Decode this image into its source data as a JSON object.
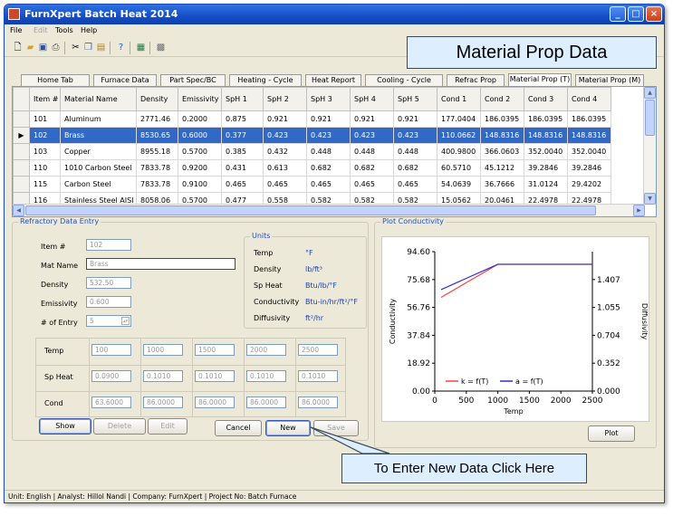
{
  "window": {
    "title": "FurnXpert Batch Heat 2014"
  },
  "menu": {
    "file": "File",
    "edit": "Edit",
    "tools": "Tools",
    "help": "Help"
  },
  "callouts": {
    "material_prop": "Material Prop Data",
    "new_data": "To Enter New Data Click Here"
  },
  "tabs": [
    "Home Tab",
    "Furnace Data",
    "Part Spec/BC",
    "Heating - Cycle",
    "Heat Report",
    "Cooling - Cycle",
    "Refrac Prop",
    "Material Prop (T)",
    "Material Prop (M)"
  ],
  "grid": {
    "columns": [
      "Item #",
      "Material Name",
      "Density",
      "Emissivity",
      "SpH 1",
      "SpH 2",
      "SpH 3",
      "SpH 4",
      "SpH 5",
      "Cond 1",
      "Cond 2",
      "Cond 3",
      "Cond 4"
    ],
    "rows": [
      [
        "101",
        "Aluminum",
        "2771.46",
        "0.2000",
        "0.875",
        "0.921",
        "0.921",
        "0.921",
        "0.921",
        "177.0404",
        "186.0395",
        "186.0395",
        "186.0395"
      ],
      [
        "102",
        "Brass",
        "8530.65",
        "0.6000",
        "0.377",
        "0.423",
        "0.423",
        "0.423",
        "0.423",
        "110.0662",
        "148.8316",
        "148.8316",
        "148.8316"
      ],
      [
        "103",
        "Copper",
        "8955.18",
        "0.5700",
        "0.385",
        "0.432",
        "0.448",
        "0.448",
        "0.448",
        "400.9800",
        "366.0603",
        "352.0040",
        "352.0040"
      ],
      [
        "110",
        "1010 Carbon Steel",
        "7833.78",
        "0.9200",
        "0.431",
        "0.613",
        "0.682",
        "0.682",
        "0.682",
        "60.5710",
        "45.1212",
        "39.2846",
        "39.2846"
      ],
      [
        "115",
        "Carbon Steel",
        "7833.78",
        "0.9100",
        "0.465",
        "0.465",
        "0.465",
        "0.465",
        "0.465",
        "54.0639",
        "36.7666",
        "31.0124",
        "29.4202"
      ],
      [
        "116",
        "Stainless Steel AISI 3...",
        "8058.06",
        "0.5700",
        "0.477",
        "0.558",
        "0.582",
        "0.582",
        "0.582",
        "15.0562",
        "20.0461",
        "22.4978",
        "22.4978"
      ],
      [
        "118",
        "Tungsten",
        "19302.50",
        "0.5500",
        "0.130",
        "0.143",
        "0.147",
        "0.147",
        "0.147",
        "173.9253",
        "124.5647",
        "118.0269",
        "118.0269"
      ]
    ],
    "selected_row": 1
  },
  "refractory": {
    "legend": "Refractory Data Entry",
    "item_label": "Item #",
    "item_value": "102",
    "mat_label": "Mat Name",
    "mat_value": "Brass",
    "density_label": "Density",
    "density_value": "532.50",
    "emissivity_label": "Emissivity",
    "emissivity_value": "0.600",
    "entry_label": "# of Entry",
    "entry_value": "5",
    "units_legend": "Units",
    "units": [
      {
        "name": "Temp",
        "unit": "°F"
      },
      {
        "name": "Density",
        "unit": "lb/ft³"
      },
      {
        "name": "Sp Heat",
        "unit": "Btu/lb/°F"
      },
      {
        "name": "Conductivity",
        "unit": "Btu-in/hr/ft²/°F"
      },
      {
        "name": "Diffusivity",
        "unit": "ft²/hr"
      }
    ],
    "matrix_rows": [
      {
        "label": "Temp",
        "values": [
          "100",
          "1000",
          "1500",
          "2000",
          "2500"
        ]
      },
      {
        "label": "Sp Heat",
        "values": [
          "0.0900",
          "0.1010",
          "0.1010",
          "0.1010",
          "0.1010"
        ]
      },
      {
        "label": "Cond",
        "values": [
          "63.6000",
          "86.0000",
          "86.0000",
          "86.0000",
          "86.0000"
        ]
      }
    ],
    "buttons": {
      "show": "Show",
      "delete": "Delete",
      "edit": "Edit",
      "cancel": "Cancel",
      "new": "New",
      "save": "Save"
    }
  },
  "plot": {
    "legend": "Plot Conductivity",
    "plot_button": "Plot",
    "colors": {
      "k": "#ff4040",
      "a": "#3030d0"
    }
  },
  "chart_data": {
    "type": "line",
    "xlabel": "Temp",
    "ylabel": "Conductivity",
    "y2label": "Diffusivity",
    "xlim": [
      0,
      2500
    ],
    "ylim": [
      0,
      94.6
    ],
    "y2lim": [
      0,
      1.759
    ],
    "x_ticks": [
      "0",
      "500",
      "1000",
      "1500",
      "2000",
      "2500"
    ],
    "y_ticks": [
      "0.00",
      "18.92",
      "37.84",
      "56.76",
      "75.68",
      "94.60"
    ],
    "y2_ticks": [
      "0.000",
      "0.352",
      "0.704",
      "1.055",
      "1.407"
    ],
    "series": [
      {
        "name": "k = f(T)",
        "axis": "left",
        "x": [
          100,
          1000,
          1500,
          2000,
          2500
        ],
        "y": [
          63.6,
          86,
          86,
          86,
          86
        ]
      },
      {
        "name": "a = f(T)",
        "axis": "right",
        "x": [
          100,
          1000,
          1500,
          2000,
          2500
        ],
        "y": [
          1.28,
          1.6,
          1.6,
          1.6,
          1.6
        ]
      }
    ],
    "legend_position": "bottom"
  },
  "status": {
    "text": "Unit: English  | Analyst: Hillol Nandi  | Company: FurnXpert  | Project No: Batch Furnace"
  }
}
